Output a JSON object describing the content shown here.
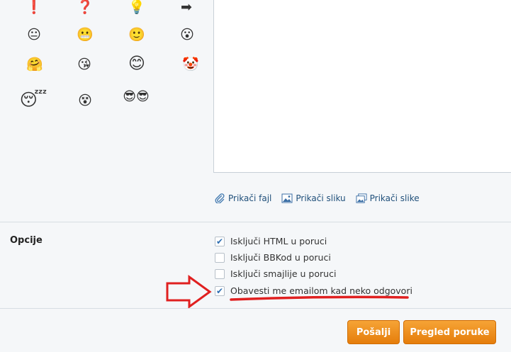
{
  "emoticons": [
    {
      "name": "exclamation-smiley-icon",
      "glyph": "❗"
    },
    {
      "name": "question-smiley-icon",
      "glyph": "❓"
    },
    {
      "name": "idea-bulb-smiley-icon",
      "glyph": "💡"
    },
    {
      "name": "arrow-right-smiley-icon",
      "glyph": "➡"
    },
    {
      "name": "neutral-smiley-icon",
      "glyph": "😐"
    },
    {
      "name": "grin-green-smiley-icon",
      "glyph": "😬"
    },
    {
      "name": "smile-smiley-icon",
      "glyph": "🙂"
    },
    {
      "name": "surprised-smiley-icon",
      "glyph": "😮"
    },
    {
      "name": "hug-smiley-icon",
      "glyph": "🤗"
    },
    {
      "name": "kiss-smiley-icon",
      "glyph": "😘"
    },
    {
      "name": "big-smile-smiley-icon",
      "glyph": "😊"
    },
    {
      "name": "clown-smiley-icon",
      "glyph": "🤡"
    },
    {
      "name": "lazy-gray-smiley-icon",
      "glyph": "😴"
    },
    {
      "name": "wallbash-smiley-icon",
      "glyph": "😵"
    },
    {
      "name": "bffs-pair-smiley-icon",
      "glyph": "😎😎"
    }
  ],
  "attachments": [
    {
      "label": "Prikači fajl",
      "icon": "paperclip-icon"
    },
    {
      "label": "Prikači sliku",
      "icon": "image-icon"
    },
    {
      "label": "Prikači slike",
      "icon": "images-icon"
    }
  ],
  "options": {
    "section_label": "Opcije",
    "items": [
      {
        "label": "Isključi HTML u poruci",
        "checked": true
      },
      {
        "label": "Isključi BBKod u poruci",
        "checked": false
      },
      {
        "label": "Isključi smajlije u poruci",
        "checked": false
      },
      {
        "label": "Obavesti me emailom kad neko odgovori",
        "checked": true
      }
    ]
  },
  "buttons": {
    "send": "Pošalji",
    "preview": "Pregled poruke"
  },
  "colors": {
    "accent_orange": "#f08c1e",
    "annotation_red": "#e02020",
    "link_blue": "#1f4f7a",
    "checkbox_blue": "#2f6fb1"
  }
}
